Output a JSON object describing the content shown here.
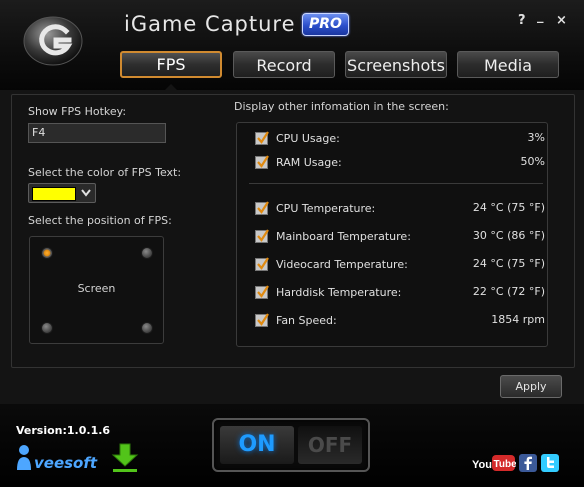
{
  "header": {
    "title": "iGame Capture",
    "badge": "PRO",
    "help": "?",
    "minimize": "_",
    "close": "×"
  },
  "tabs": [
    {
      "label": "FPS",
      "active": true
    },
    {
      "label": "Record",
      "active": false
    },
    {
      "label": "Screenshots",
      "active": false
    },
    {
      "label": "Media",
      "active": false
    }
  ],
  "fps_settings": {
    "hotkey_label": "Show FPS Hotkey:",
    "hotkey_value": "F4",
    "color_label": "Select the color of FPS Text:",
    "color_value": "#ffff00",
    "position_label": "Select the position of FPS:",
    "position_center_label": "Screen",
    "selected_position": "top-left"
  },
  "info": {
    "header": "Display other infomation in the screen:",
    "items": [
      {
        "label": "CPU Usage:",
        "value": "3%",
        "checked": true
      },
      {
        "label": "RAM Usage:",
        "value": "50%",
        "checked": true
      },
      {
        "label": "CPU Temperature:",
        "value": "24 °C (75 °F)",
        "checked": true
      },
      {
        "label": "Mainboard Temperature:",
        "value": "30 °C (86 °F)",
        "checked": true
      },
      {
        "label": "Videocard Temperature:",
        "value": "24 °C (75 °F)",
        "checked": true
      },
      {
        "label": "Harddisk Temperature:",
        "value": "22 °C (72 °F)",
        "checked": true
      },
      {
        "label": "Fan Speed:",
        "value": "1854 rpm",
        "checked": true
      }
    ]
  },
  "apply_label": "Apply",
  "footer": {
    "version": "Version:1.0.1.6",
    "company": "veesoft",
    "switch_on": "ON",
    "switch_off": "OFF",
    "switch_state": "on"
  },
  "colors": {
    "accent": "#d08a30",
    "switch_on": "#1e9bff",
    "check": "#e08a10"
  },
  "icons": [
    "logo-icon",
    "chevron-down-icon",
    "checkmark-icon",
    "download-icon",
    "youtube-icon",
    "facebook-icon",
    "twitter-icon"
  ]
}
